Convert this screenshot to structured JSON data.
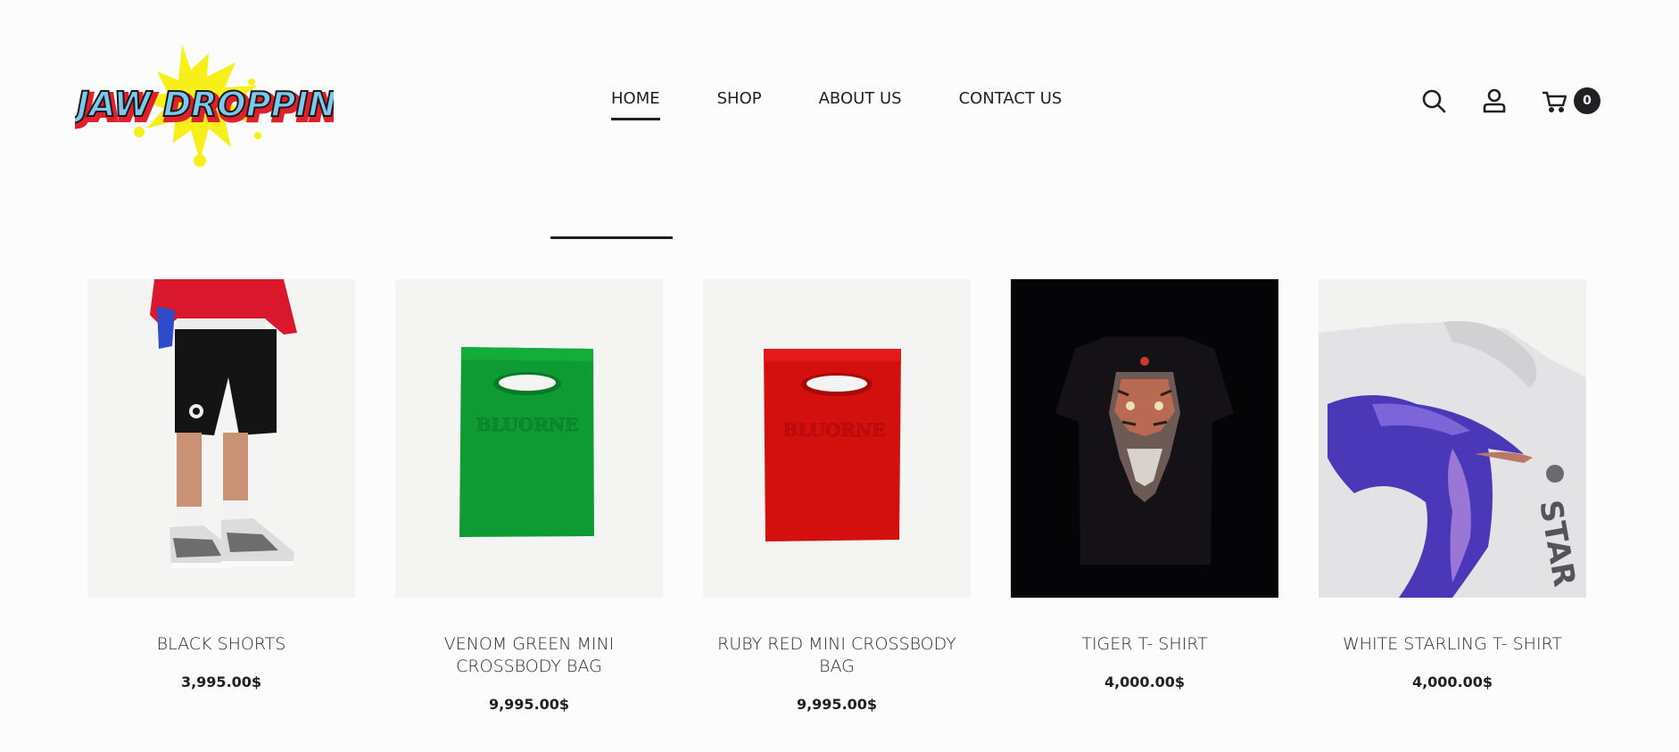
{
  "header": {
    "logo_text": "JAW DROPPING",
    "nav": [
      {
        "label": "HOME",
        "active": true
      },
      {
        "label": "SHOP",
        "active": false
      },
      {
        "label": "ABOUT US",
        "active": false
      },
      {
        "label": "CONTACT US",
        "active": false
      }
    ],
    "icons": [
      "search-icon",
      "user-icon",
      "cart-icon"
    ],
    "cart_count": "0"
  },
  "products": [
    {
      "name": "BLACK SHORTS",
      "price": "3,995.00$",
      "image": "black-shorts-photo"
    },
    {
      "name": "VENOM GREEN MINI CROSSBODY BAG",
      "price": "9,995.00$",
      "image": "green-bag-photo"
    },
    {
      "name": "RUBY RED MINI CROSSBODY BAG",
      "price": "9,995.00$",
      "image": "red-bag-photo"
    },
    {
      "name": "TIGER T- SHIRT",
      "price": "4,000.00$",
      "image": "tiger-tshirt-photo"
    },
    {
      "name": "WHITE STARLING T- SHIRT",
      "price": "4,000.00$",
      "image": "white-starling-tshirt-photo"
    }
  ],
  "colors": {
    "text": "#1f1f24",
    "background": "#fbfcfb",
    "logo_yellow": "#f7ef1a",
    "logo_blue": "#7cc8ee",
    "logo_red": "#e0202a"
  }
}
